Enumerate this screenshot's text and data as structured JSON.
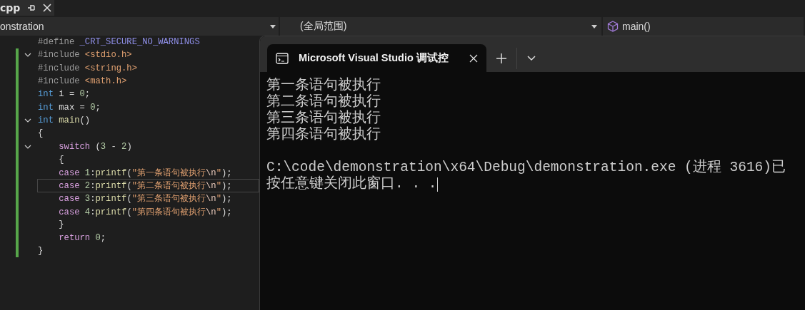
{
  "document_tab": {
    "title": "cpp"
  },
  "navigation_bar": {
    "project": "onstration",
    "scope": "(全局范围)",
    "member": "main()"
  },
  "editor": {
    "lines": [
      {
        "fold": false,
        "modified": false,
        "current": false,
        "tokens": [
          {
            "kind": "preproc",
            "text": "#define "
          },
          {
            "kind": "macro",
            "text": "_CRT_SECURE_NO_WARNINGS"
          }
        ]
      },
      {
        "fold": true,
        "modified": true,
        "current": false,
        "tokens": [
          {
            "kind": "preproc",
            "text": "#include "
          },
          {
            "kind": "header",
            "text": "<stdio.h>"
          }
        ]
      },
      {
        "fold": false,
        "modified": true,
        "current": false,
        "tokens": [
          {
            "kind": "preproc",
            "text": "#include "
          },
          {
            "kind": "header",
            "text": "<string.h>"
          }
        ]
      },
      {
        "fold": false,
        "modified": true,
        "current": false,
        "tokens": [
          {
            "kind": "preproc",
            "text": "#include "
          },
          {
            "kind": "header",
            "text": "<math.h>"
          }
        ]
      },
      {
        "fold": false,
        "modified": true,
        "current": false,
        "tokens": [
          {
            "kind": "type",
            "text": "int"
          },
          {
            "kind": "plain",
            "text": " i = "
          },
          {
            "kind": "number",
            "text": "0"
          },
          {
            "kind": "plain",
            "text": ";"
          }
        ]
      },
      {
        "fold": false,
        "modified": true,
        "current": false,
        "tokens": [
          {
            "kind": "type",
            "text": "int"
          },
          {
            "kind": "plain",
            "text": " max = "
          },
          {
            "kind": "number",
            "text": "0"
          },
          {
            "kind": "plain",
            "text": ";"
          }
        ]
      },
      {
        "fold": true,
        "modified": true,
        "current": false,
        "tokens": [
          {
            "kind": "type",
            "text": "int "
          },
          {
            "kind": "function",
            "text": "main"
          },
          {
            "kind": "plain",
            "text": "()"
          }
        ]
      },
      {
        "fold": false,
        "modified": true,
        "current": false,
        "tokens": [
          {
            "kind": "plain",
            "text": "{"
          }
        ]
      },
      {
        "fold": true,
        "modified": true,
        "current": false,
        "tokens": [
          {
            "kind": "control",
            "text": "    switch"
          },
          {
            "kind": "plain",
            "text": " ("
          },
          {
            "kind": "number",
            "text": "3"
          },
          {
            "kind": "plain",
            "text": " - "
          },
          {
            "kind": "number",
            "text": "2"
          },
          {
            "kind": "plain",
            "text": ")"
          }
        ]
      },
      {
        "fold": false,
        "modified": true,
        "current": false,
        "tokens": [
          {
            "kind": "plain",
            "text": "    {"
          }
        ]
      },
      {
        "fold": false,
        "modified": true,
        "current": false,
        "tokens": [
          {
            "kind": "control",
            "text": "    case "
          },
          {
            "kind": "number",
            "text": "1"
          },
          {
            "kind": "plain",
            "text": ":"
          },
          {
            "kind": "function",
            "text": "printf"
          },
          {
            "kind": "plain",
            "text": "("
          },
          {
            "kind": "string",
            "text": "\"第一条语句被执行"
          },
          {
            "kind": "escape",
            "text": "\\n"
          },
          {
            "kind": "string",
            "text": "\""
          },
          {
            "kind": "plain",
            "text": ");"
          }
        ]
      },
      {
        "fold": false,
        "modified": true,
        "current": true,
        "tokens": [
          {
            "kind": "control",
            "text": "    case "
          },
          {
            "kind": "number",
            "text": "2"
          },
          {
            "kind": "plain",
            "text": ":"
          },
          {
            "kind": "function",
            "text": "printf"
          },
          {
            "kind": "plain",
            "text": "("
          },
          {
            "kind": "string",
            "text": "\"第二条语句被执行"
          },
          {
            "kind": "escape",
            "text": "\\n"
          },
          {
            "kind": "string",
            "text": "\""
          },
          {
            "kind": "plain",
            "text": ");"
          }
        ]
      },
      {
        "fold": false,
        "modified": true,
        "current": false,
        "tokens": [
          {
            "kind": "control",
            "text": "    case "
          },
          {
            "kind": "number",
            "text": "3"
          },
          {
            "kind": "plain",
            "text": ":"
          },
          {
            "kind": "function",
            "text": "printf"
          },
          {
            "kind": "plain",
            "text": "("
          },
          {
            "kind": "string",
            "text": "\"第三条语句被执行"
          },
          {
            "kind": "escape",
            "text": "\\n"
          },
          {
            "kind": "string",
            "text": "\""
          },
          {
            "kind": "plain",
            "text": ");"
          }
        ]
      },
      {
        "fold": false,
        "modified": true,
        "current": false,
        "tokens": [
          {
            "kind": "control",
            "text": "    case "
          },
          {
            "kind": "number",
            "text": "4"
          },
          {
            "kind": "plain",
            "text": ":"
          },
          {
            "kind": "function",
            "text": "printf"
          },
          {
            "kind": "plain",
            "text": "("
          },
          {
            "kind": "string",
            "text": "\"第四条语句被执行"
          },
          {
            "kind": "escape",
            "text": "\\n"
          },
          {
            "kind": "string",
            "text": "\""
          },
          {
            "kind": "plain",
            "text": ");"
          }
        ]
      },
      {
        "fold": false,
        "modified": true,
        "current": false,
        "tokens": [
          {
            "kind": "plain",
            "text": "    }"
          }
        ]
      },
      {
        "fold": false,
        "modified": true,
        "current": false,
        "tokens": [
          {
            "kind": "control",
            "text": "    return "
          },
          {
            "kind": "number",
            "text": "0"
          },
          {
            "kind": "plain",
            "text": ";"
          }
        ]
      },
      {
        "fold": false,
        "modified": true,
        "current": false,
        "tokens": [
          {
            "kind": "plain",
            "text": "}"
          }
        ]
      }
    ]
  },
  "console": {
    "tab_title": "Microsoft Visual Studio 调试控",
    "output": [
      {
        "text": "第一条语句被执行",
        "blank_before": false
      },
      {
        "text": "第二条语句被执行",
        "blank_before": false
      },
      {
        "text": "第三条语句被执行",
        "blank_before": false
      },
      {
        "text": "第四条语句被执行",
        "blank_before": false
      },
      {
        "text": "C:\\code\\demonstration\\x64\\Debug\\demonstration.exe (进程 3616)已",
        "blank_before": true
      },
      {
        "text": "按任意键关闭此窗口. . .",
        "blank_before": false
      }
    ],
    "cursor": true
  }
}
